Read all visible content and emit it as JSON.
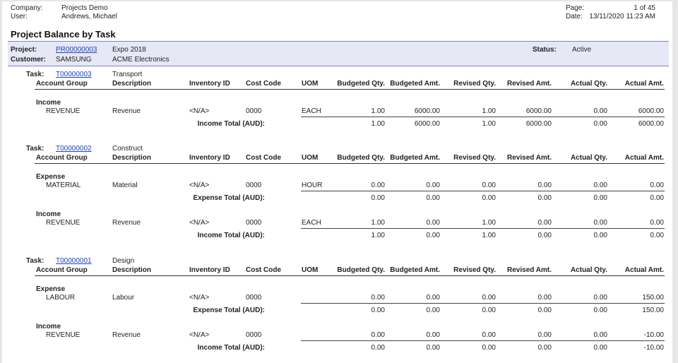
{
  "header": {
    "company_label": "Company:",
    "company": "Projects Demo",
    "user_label": "User:",
    "user": "Andrews, Michael",
    "page_label": "Page:",
    "page": "1 of 45",
    "date_label": "Date:",
    "date": "13/11/2020 11:23 AM"
  },
  "report_title": "Project Balance by Task",
  "project": {
    "project_label": "Project:",
    "project_id": "PR00000003",
    "project_name": "Expo 2018",
    "customer_label": "Customer:",
    "customer_id": "SAMSUNG",
    "customer_name": "ACME Electronics",
    "status_label": "Status:",
    "status": "Active"
  },
  "columns": {
    "account_group": "Account Group",
    "description": "Description",
    "inventory_id": "Inventory ID",
    "cost_code": "Cost Code",
    "uom": "UOM",
    "budgeted_qty": "Budgeted Qty.",
    "budgeted_amt": "Budgeted Amt.",
    "revised_qty": "Revised Qty.",
    "revised_amt": "Revised Amt.",
    "actual_qty": "Actual Qty.",
    "actual_amt": "Actual Amt."
  },
  "task_label": "Task:",
  "tasks": [
    {
      "task_id": "T00000003",
      "task_desc": "Transport",
      "groups": [
        {
          "name": "Income",
          "line": {
            "account": "REVENUE",
            "description": "Revenue",
            "inventory_id": "<N/A>",
            "cost_code": "0000",
            "uom": "EACH",
            "budgeted_qty": "1.00",
            "budgeted_amt": "6000.00",
            "revised_qty": "1.00",
            "revised_amt": "6000.00",
            "actual_qty": "0.00",
            "actual_amt": "6000.00"
          },
          "total": {
            "label": "Income Total (AUD):",
            "budgeted_qty": "1.00",
            "budgeted_amt": "6000.00",
            "revised_qty": "1.00",
            "revised_amt": "6000.00",
            "actual_qty": "0.00",
            "actual_amt": "6000.00"
          }
        }
      ]
    },
    {
      "task_id": "T00000002",
      "task_desc": "Construct",
      "groups": [
        {
          "name": "Expense",
          "line": {
            "account": "MATERIAL",
            "description": "Material",
            "inventory_id": "<N/A>",
            "cost_code": "0000",
            "uom": "HOUR",
            "budgeted_qty": "0.00",
            "budgeted_amt": "0.00",
            "revised_qty": "0.00",
            "revised_amt": "0.00",
            "actual_qty": "0.00",
            "actual_amt": "0.00"
          },
          "total": {
            "label": "Expense Total (AUD):",
            "budgeted_qty": "0.00",
            "budgeted_amt": "0.00",
            "revised_qty": "0.00",
            "revised_amt": "0.00",
            "actual_qty": "0.00",
            "actual_amt": "0.00"
          }
        },
        {
          "name": "Income",
          "line": {
            "account": "REVENUE",
            "description": "Revenue",
            "inventory_id": "<N/A>",
            "cost_code": "0000",
            "uom": "EACH",
            "budgeted_qty": "1.00",
            "budgeted_amt": "0.00",
            "revised_qty": "1.00",
            "revised_amt": "0.00",
            "actual_qty": "0.00",
            "actual_amt": "0.00"
          },
          "total": {
            "label": "Income Total (AUD):",
            "budgeted_qty": "1.00",
            "budgeted_amt": "0.00",
            "revised_qty": "1.00",
            "revised_amt": "0.00",
            "actual_qty": "0.00",
            "actual_amt": "0.00"
          }
        }
      ]
    },
    {
      "task_id": "T00000001",
      "task_desc": "Design",
      "groups": [
        {
          "name": "Expense",
          "line": {
            "account": "LABOUR",
            "description": "Labour",
            "inventory_id": "<N/A>",
            "cost_code": "0000",
            "uom": "",
            "budgeted_qty": "0.00",
            "budgeted_amt": "0.00",
            "revised_qty": "0.00",
            "revised_amt": "0.00",
            "actual_qty": "0.00",
            "actual_amt": "150.00"
          },
          "total": {
            "label": "Expense Total (AUD):",
            "budgeted_qty": "0.00",
            "budgeted_amt": "0.00",
            "revised_qty": "0.00",
            "revised_amt": "0.00",
            "actual_qty": "0.00",
            "actual_amt": "150.00"
          }
        },
        {
          "name": "Income",
          "line": {
            "account": "REVENUE",
            "description": "Revenue",
            "inventory_id": "<N/A>",
            "cost_code": "0000",
            "uom": "",
            "budgeted_qty": "0.00",
            "budgeted_amt": "0.00",
            "revised_qty": "0.00",
            "revised_amt": "0.00",
            "actual_qty": "0.00",
            "actual_amt": "-10.00"
          },
          "total": {
            "label": "Income Total (AUD):",
            "budgeted_qty": "0.00",
            "budgeted_amt": "0.00",
            "revised_qty": "0.00",
            "revised_amt": "0.00",
            "actual_qty": "0.00",
            "actual_amt": "-10.00"
          }
        }
      ]
    }
  ]
}
